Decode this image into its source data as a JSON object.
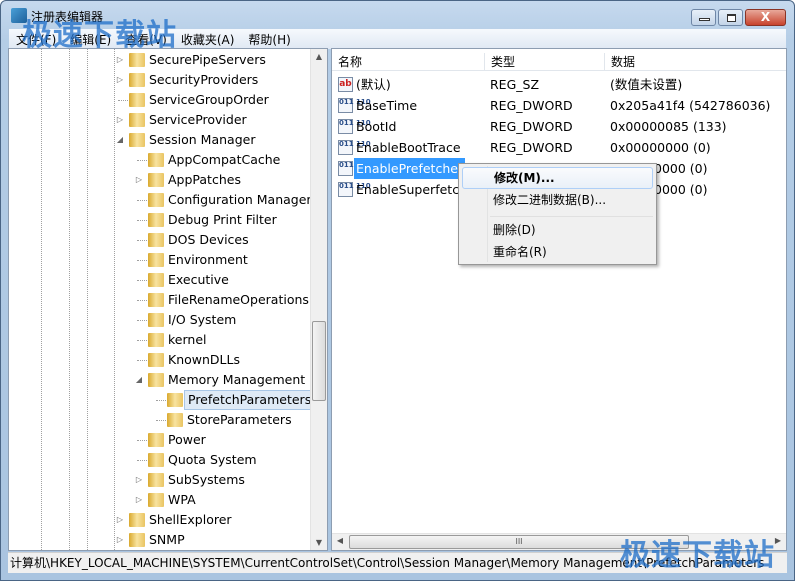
{
  "window": {
    "title": "注册表编辑器",
    "close_glyph": "X"
  },
  "menu": [
    "文件(F)",
    "编辑(E)",
    "查看(V)",
    "收藏夹(A)",
    "帮助(H)"
  ],
  "tree": [
    {
      "label": "SecurePipeServers",
      "level": 1,
      "state": "collapsed"
    },
    {
      "label": "SecurityProviders",
      "level": 1,
      "state": "collapsed"
    },
    {
      "label": "ServiceGroupOrder",
      "level": 1,
      "state": "none"
    },
    {
      "label": "ServiceProvider",
      "level": 1,
      "state": "collapsed"
    },
    {
      "label": "Session Manager",
      "level": 1,
      "state": "expanded"
    },
    {
      "label": "AppCompatCache",
      "level": 2,
      "state": "none"
    },
    {
      "label": "AppPatches",
      "level": 2,
      "state": "collapsed"
    },
    {
      "label": "Configuration Manager",
      "level": 2,
      "state": "none"
    },
    {
      "label": "Debug Print Filter",
      "level": 2,
      "state": "none"
    },
    {
      "label": "DOS Devices",
      "level": 2,
      "state": "none"
    },
    {
      "label": "Environment",
      "level": 2,
      "state": "none"
    },
    {
      "label": "Executive",
      "level": 2,
      "state": "none"
    },
    {
      "label": "FileRenameOperations",
      "level": 2,
      "state": "none"
    },
    {
      "label": "I/O System",
      "level": 2,
      "state": "none"
    },
    {
      "label": "kernel",
      "level": 2,
      "state": "none"
    },
    {
      "label": "KnownDLLs",
      "level": 2,
      "state": "none"
    },
    {
      "label": "Memory Management",
      "level": 2,
      "state": "expanded"
    },
    {
      "label": "PrefetchParameters",
      "level": 3,
      "state": "none",
      "selected": true
    },
    {
      "label": "StoreParameters",
      "level": 3,
      "state": "none"
    },
    {
      "label": "Power",
      "level": 2,
      "state": "none"
    },
    {
      "label": "Quota System",
      "level": 2,
      "state": "none"
    },
    {
      "label": "SubSystems",
      "level": 2,
      "state": "collapsed"
    },
    {
      "label": "WPA",
      "level": 2,
      "state": "collapsed"
    },
    {
      "label": "ShellExplorer",
      "level": 1,
      "state": "collapsed"
    },
    {
      "label": "SNMP",
      "level": 1,
      "state": "collapsed"
    }
  ],
  "list": {
    "columns": [
      "名称",
      "类型",
      "数据"
    ],
    "rows": [
      {
        "icon": "string-value-icon",
        "icon_text": "ab",
        "name": "(默认)",
        "type": "REG_SZ",
        "data": "(数值未设置)"
      },
      {
        "icon": "binary-value-icon",
        "icon_text": "011 110",
        "name": "BaseTime",
        "type": "REG_DWORD",
        "data": "0x205a41f4 (542786036)"
      },
      {
        "icon": "binary-value-icon",
        "icon_text": "011 110",
        "name": "BootId",
        "type": "REG_DWORD",
        "data": "0x00000085 (133)"
      },
      {
        "icon": "binary-value-icon",
        "icon_text": "011 110",
        "name": "EnableBootTrace",
        "type": "REG_DWORD",
        "data": "0x00000000 (0)"
      },
      {
        "icon": "binary-value-icon",
        "icon_text": "011 110",
        "name": "EnablePrefetcher",
        "type": "",
        "data": "0000 (0)",
        "selected": true
      },
      {
        "icon": "binary-value-icon",
        "icon_text": "011 110",
        "name": "EnableSuperfetch",
        "type": "",
        "data": "0000 (0)"
      }
    ]
  },
  "context_menu": [
    "修改(M)...",
    "修改二进制数据(B)...",
    "删除(D)",
    "重命名(R)"
  ],
  "status": "计算机\\HKEY_LOCAL_MACHINE\\SYSTEM\\CurrentControlSet\\Control\\Session Manager\\Memory Management\\PrefetchParameters",
  "watermark": "极速下载站"
}
